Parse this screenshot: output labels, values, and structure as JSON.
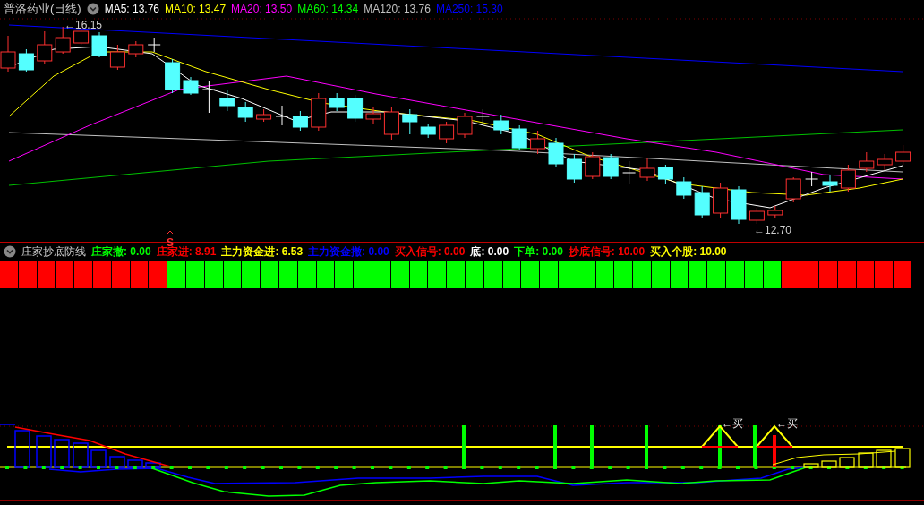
{
  "title_bar": {
    "stock": "普洛药业(日线)",
    "indicators": [
      {
        "label": "MA5: 13.76",
        "color": "#ffffff"
      },
      {
        "label": "MA10: 13.47",
        "color": "#ffff00"
      },
      {
        "label": "MA20: 13.50",
        "color": "#ff00ff"
      },
      {
        "label": "MA60: 14.34",
        "color": "#00ff00"
      },
      {
        "label": "MA120: 13.76",
        "color": "#c0c0c0"
      },
      {
        "label": "MA250: 15.30",
        "color": "#0000ff"
      }
    ]
  },
  "main_chart": {
    "high_label": "←16.15",
    "low_label": "←12.70",
    "signal_mark": "S"
  },
  "indicator_panel": {
    "name": "庄家抄底防线",
    "values": [
      {
        "label": "庄家撤: 0.00",
        "color": "#00ff00"
      },
      {
        "label": "庄家进: 8.91",
        "color": "#ff0000"
      },
      {
        "label": "主力资金进: 6.53",
        "color": "#ffff00"
      },
      {
        "label": "主力资金撤: 0.00",
        "color": "#0000ff"
      },
      {
        "label": "买入信号: 0.00",
        "color": "#ff0000"
      },
      {
        "label": "底: 0.00",
        "color": "#ffffff"
      },
      {
        "label": "下单: 0.00",
        "color": "#00ff00"
      },
      {
        "label": "抄底信号: 10.00",
        "color": "#ff0000"
      },
      {
        "label": "买入个股: 10.00",
        "color": "#ffff00"
      }
    ],
    "signal_bars": [
      {
        "color": "#ff0000"
      },
      {
        "color": "#ff0000"
      },
      {
        "color": "#ff0000"
      },
      {
        "color": "#ff0000"
      },
      {
        "color": "#ff0000"
      },
      {
        "color": "#ff0000"
      },
      {
        "color": "#ff0000"
      },
      {
        "color": "#ff0000"
      },
      {
        "color": "#ff0000"
      },
      {
        "color": "#00ff00"
      },
      {
        "color": "#00ff00"
      },
      {
        "color": "#00ff00"
      },
      {
        "color": "#00ff00"
      },
      {
        "color": "#00ff00"
      },
      {
        "color": "#00ff00"
      },
      {
        "color": "#00ff00"
      },
      {
        "color": "#00ff00"
      },
      {
        "color": "#00ff00"
      },
      {
        "color": "#00ff00"
      },
      {
        "color": "#00ff00"
      },
      {
        "color": "#00ff00"
      },
      {
        "color": "#00ff00"
      },
      {
        "color": "#00ff00"
      },
      {
        "color": "#00ff00"
      },
      {
        "color": "#00ff00"
      },
      {
        "color": "#00ff00"
      },
      {
        "color": "#00ff00"
      },
      {
        "color": "#00ff00"
      },
      {
        "color": "#00ff00"
      },
      {
        "color": "#00ff00"
      },
      {
        "color": "#00ff00"
      },
      {
        "color": "#00ff00"
      },
      {
        "color": "#00ff00"
      },
      {
        "color": "#00ff00"
      },
      {
        "color": "#00ff00"
      },
      {
        "color": "#00ff00"
      },
      {
        "color": "#00ff00"
      },
      {
        "color": "#00ff00"
      },
      {
        "color": "#00ff00"
      },
      {
        "color": "#00ff00"
      },
      {
        "color": "#00ff00"
      },
      {
        "color": "#00ff00"
      },
      {
        "color": "#ff0000"
      },
      {
        "color": "#ff0000"
      },
      {
        "color": "#ff0000"
      },
      {
        "color": "#ff0000"
      },
      {
        "color": "#ff0000"
      },
      {
        "color": "#ff0000"
      },
      {
        "color": "#ff0000"
      }
    ],
    "buy_labels": [
      "←买",
      "←买"
    ]
  }
}
